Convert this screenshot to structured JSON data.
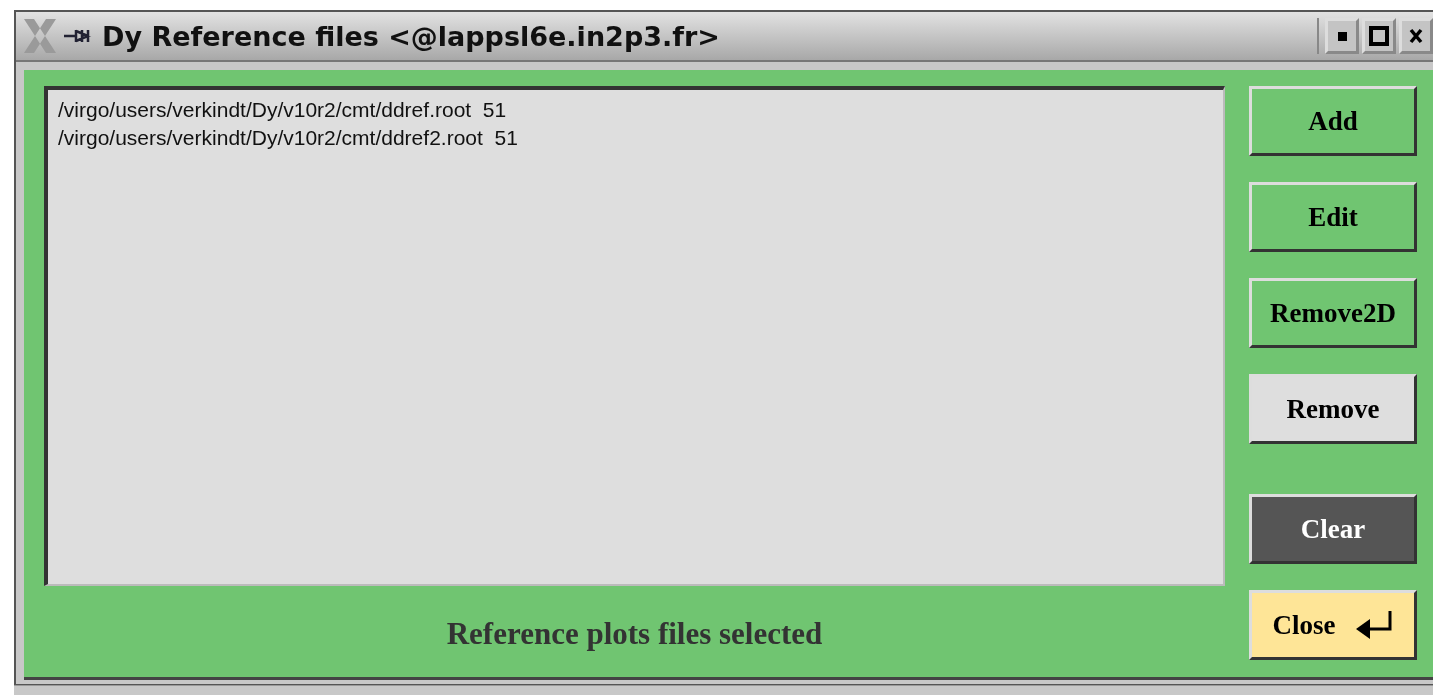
{
  "window": {
    "title": "Dy Reference files <@lappsl6e.in2p3.fr>"
  },
  "list": {
    "items": [
      {
        "text": "/virgo/users/verkindt/Dy/v10r2/cmt/ddref.root  51"
      },
      {
        "text": "/virgo/users/verkindt/Dy/v10r2/cmt/ddref2.root  51"
      }
    ]
  },
  "buttons": [
    {
      "label": "Add",
      "kind": "green"
    },
    {
      "label": "Edit",
      "kind": "green"
    },
    {
      "label": "Remove2D",
      "kind": "green"
    },
    {
      "label": "Remove",
      "kind": "grey"
    },
    {
      "label": "Clear",
      "kind": "dark"
    },
    {
      "label": "Close",
      "kind": "default"
    }
  ],
  "status": "Reference plots files selected"
}
